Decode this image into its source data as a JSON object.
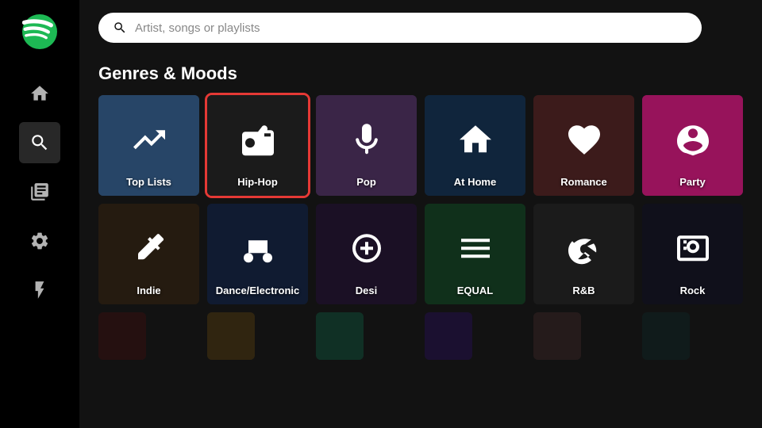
{
  "sidebar": {
    "logo_label": "Spotify",
    "icons": [
      {
        "name": "home-icon",
        "label": "Home",
        "active": false
      },
      {
        "name": "search-icon",
        "label": "Search",
        "active": true
      },
      {
        "name": "library-icon",
        "label": "Your Library",
        "active": false
      },
      {
        "name": "settings-icon",
        "label": "Settings",
        "active": false
      },
      {
        "name": "lightning-icon",
        "label": "What's New",
        "active": false
      }
    ]
  },
  "search": {
    "placeholder": "Artist, songs or playlists"
  },
  "section": {
    "title": "Genres & Moods"
  },
  "row1": [
    {
      "id": "top-lists",
      "label": "Top Lists",
      "icon": "trending",
      "bg": "#3d6b9e"
    },
    {
      "id": "hip-hop",
      "label": "Hip-Hop",
      "icon": "radio",
      "bg": "#2a2a2a",
      "selected": true
    },
    {
      "id": "pop",
      "label": "Pop",
      "icon": "mic",
      "bg": "#5a3a6e"
    },
    {
      "id": "at-home",
      "label": "At Home",
      "icon": "home",
      "bg": "#1a3a5c"
    },
    {
      "id": "romance",
      "label": "Romance",
      "icon": "heart",
      "bg": "#5c2a2a"
    },
    {
      "id": "party",
      "label": "Party",
      "icon": "party",
      "bg": "#e91e8c"
    }
  ],
  "row2": [
    {
      "id": "indie",
      "label": "Indie",
      "icon": "guitar",
      "bg": "#3a2a1a"
    },
    {
      "id": "dance",
      "label": "Dance/Electronic",
      "icon": "dj",
      "bg": "#1a2a4c"
    },
    {
      "id": "desi",
      "label": "Desi",
      "icon": "sitar",
      "bg": "#2a1a3a"
    },
    {
      "id": "equal",
      "label": "EQUAL",
      "icon": "equal",
      "bg": "#1a4a2a"
    },
    {
      "id": "rb",
      "label": "R&B",
      "icon": "glasses",
      "bg": "#2a2a2a"
    },
    {
      "id": "rock",
      "label": "Rock",
      "icon": "amp",
      "bg": "#1a1a2a"
    }
  ],
  "row3": [
    {
      "id": "r1",
      "label": "",
      "icon": "",
      "bg": "#3a1a1a"
    },
    {
      "id": "r2",
      "label": "",
      "icon": "",
      "bg": "#4a3a1a"
    },
    {
      "id": "r3",
      "label": "",
      "icon": "",
      "bg": "#1a4a3a"
    },
    {
      "id": "r4",
      "label": "",
      "icon": "",
      "bg": "#2a1a4a"
    },
    {
      "id": "r5",
      "label": "",
      "icon": "",
      "bg": "#3a2a2a"
    },
    {
      "id": "r6",
      "label": "",
      "icon": "",
      "bg": "#1a2a2a"
    }
  ]
}
